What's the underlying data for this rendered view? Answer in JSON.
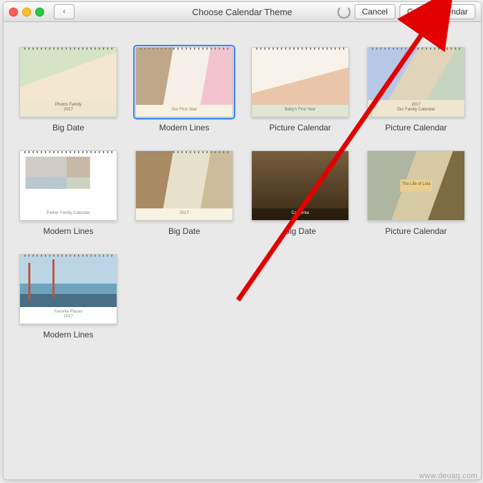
{
  "window": {
    "title": "Choose Calendar Theme",
    "back_glyph": "‹",
    "cancel_label": "Cancel",
    "create_label": "Create Calendar"
  },
  "themes": [
    {
      "label": "Big Date",
      "caption1": "Photos Family",
      "caption2": "2017",
      "strip": "strip-tan",
      "photo": "p-family",
      "selected": false
    },
    {
      "label": "Modern Lines",
      "caption1": "Our First Year",
      "caption2": "",
      "strip": "strip-cream",
      "photo": "p-wedding",
      "selected": true
    },
    {
      "label": "Picture Calendar",
      "caption1": "Baby's First Year",
      "caption2": "",
      "strip": "strip-sage",
      "photo": "p-baby",
      "selected": false
    },
    {
      "label": "Picture Calendar",
      "caption1": "2017",
      "caption2": "Our Family Calendar",
      "strip": "strip-tan",
      "photo": "p-kids",
      "selected": false
    },
    {
      "label": "Modern Lines",
      "caption1": "Parker Family Calendar",
      "caption2": "",
      "strip": "strip-white",
      "photo": "p-collage",
      "selected": false
    },
    {
      "label": "Big Date",
      "caption1": "2017",
      "caption2": "",
      "strip": "strip-cream",
      "photo": "p-portrait",
      "selected": false
    },
    {
      "label": "Big Date",
      "caption1": "California",
      "caption2": "",
      "strip": "strip-dark",
      "photo": "p-cal",
      "selected": false
    },
    {
      "label": "Picture Calendar",
      "caption1": "The Life of Lola",
      "caption2": "",
      "strip": "strip-gold",
      "photo": "p-dog",
      "selected": false
    },
    {
      "label": "Modern Lines",
      "caption1": "Favorite Places",
      "caption2": "2017",
      "strip": "strip-white",
      "photo": "p-bridge",
      "selected": false
    }
  ],
  "watermark": "www.deuaq.com"
}
